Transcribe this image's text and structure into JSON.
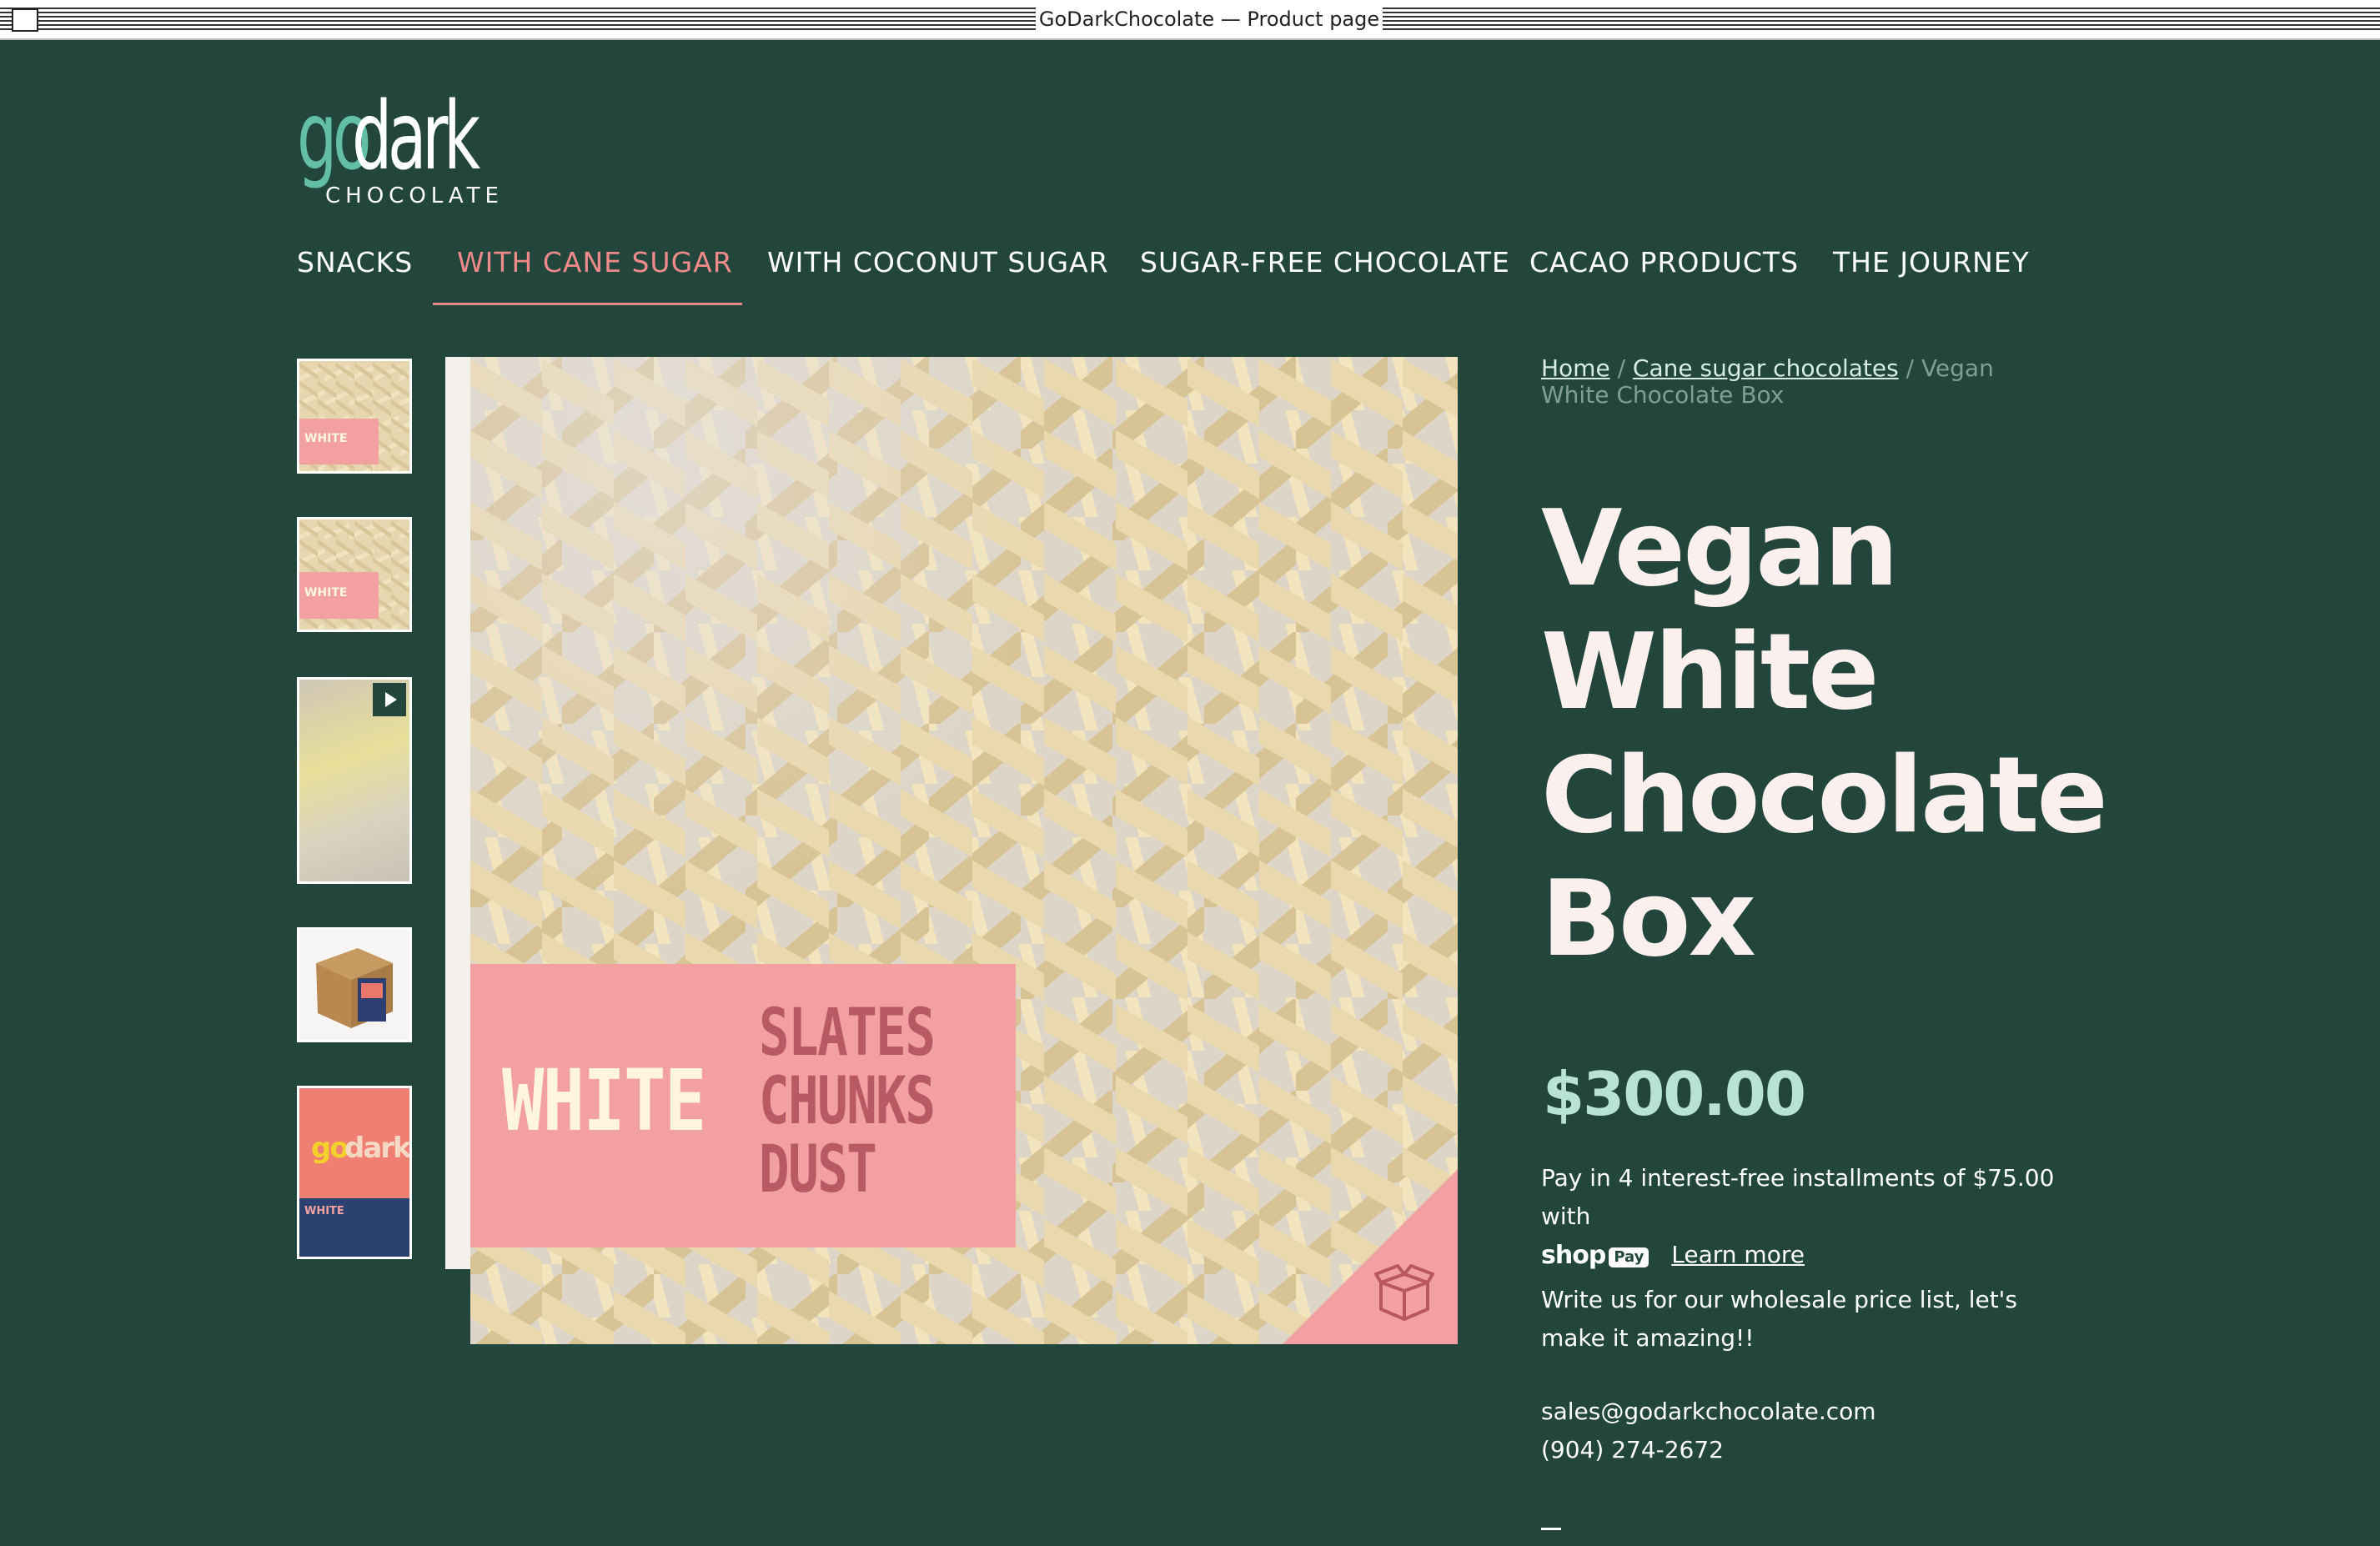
{
  "window": {
    "title": "GoDarkChocolate — Product page"
  },
  "logo": {
    "go": "go",
    "dark": "dark",
    "sub": "CHOCOLATE"
  },
  "nav": {
    "items": [
      {
        "label": "SNACKS",
        "active": false
      },
      {
        "label": "WITH CANE SUGAR",
        "active": true
      },
      {
        "label": "WITH COCONUT SUGAR",
        "active": false
      },
      {
        "label": "SUGAR-FREE CHOCOLATE",
        "active": false
      },
      {
        "label": "CACAO PRODUCTS",
        "active": false
      },
      {
        "label": "THE JOURNEY",
        "active": false
      }
    ]
  },
  "gallery": {
    "thumbnails": [
      {
        "kind": "image",
        "label": "WHITE"
      },
      {
        "kind": "image",
        "label": "WHITE"
      },
      {
        "kind": "video",
        "icon": "play-icon"
      },
      {
        "kind": "image",
        "label": ""
      },
      {
        "kind": "image",
        "label": "WHITE"
      }
    ],
    "main_image": {
      "label_white": "WHITE",
      "label_slates": "SLATES",
      "label_chunks": "CHUNKS",
      "label_dust": "DUST",
      "corner_icon": "box-icon"
    }
  },
  "breadcrumb": {
    "home": "Home",
    "sep1": " / ",
    "category": "Cane sugar chocolates",
    "sep2": " / ",
    "current": "Vegan White Chocolate Box"
  },
  "product": {
    "title": "Vegan White Chocolate Box",
    "price": "$300.00",
    "installments_text": "Pay in 4 interest-free installments of $75.00 with",
    "shoppay_shop": "shop",
    "shoppay_pay": "Pay",
    "learn_more": "Learn more",
    "wholesale_text": "Write us for our wholesale price list, let's make it amazing!!",
    "email": "sales@godarkchocolate.com",
    "phone": "(904) 274-2672"
  },
  "colors": {
    "background": "#22463b",
    "accent_pink": "#f08a8a",
    "price_mint": "#b9e2d6",
    "title": "#fcf0ef"
  }
}
